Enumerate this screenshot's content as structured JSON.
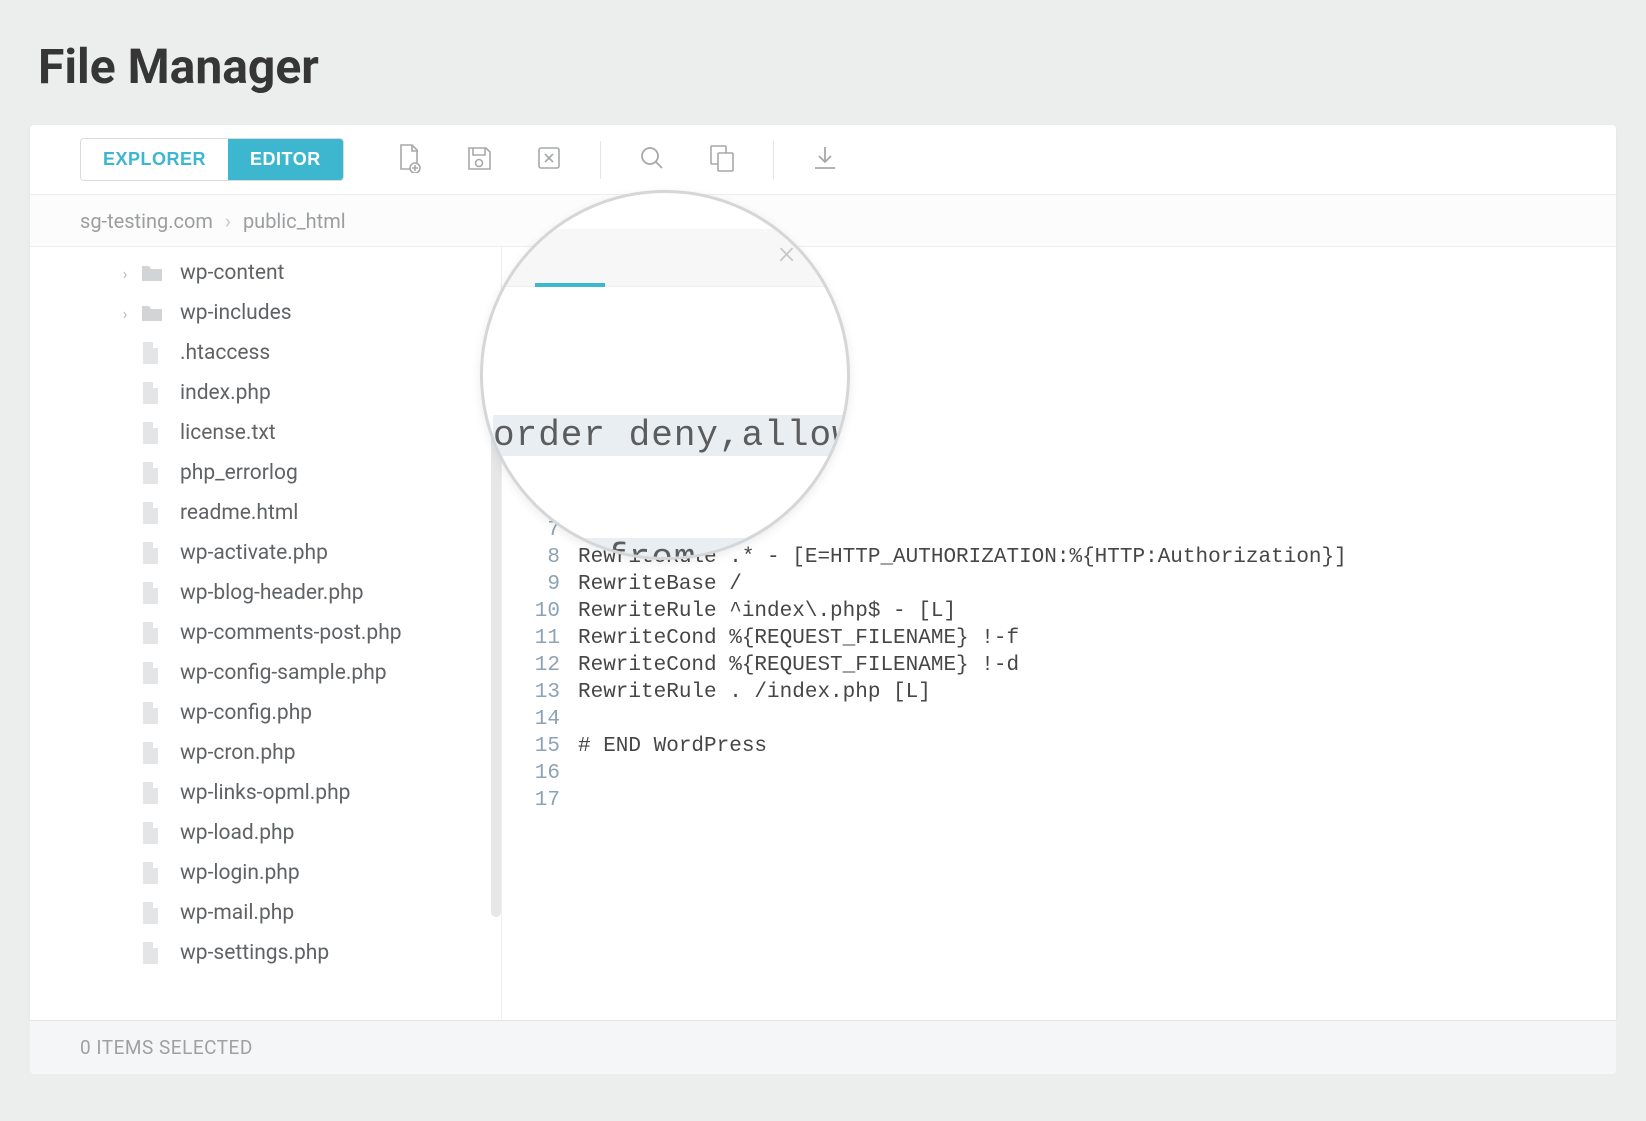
{
  "page": {
    "title": "File Manager"
  },
  "toolbar": {
    "tabs": {
      "explorer": "EXPLORER",
      "editor": "EDITOR",
      "active": "editor"
    }
  },
  "breadcrumb": {
    "parts": [
      "sg-testing.com",
      "public_html"
    ]
  },
  "sidebar": {
    "items": [
      {
        "type": "folder",
        "expandable": true,
        "label": "wp-content"
      },
      {
        "type": "folder",
        "expandable": true,
        "label": "wp-includes"
      },
      {
        "type": "file",
        "label": ".htaccess"
      },
      {
        "type": "file",
        "label": "index.php"
      },
      {
        "type": "file",
        "label": "license.txt"
      },
      {
        "type": "file",
        "label": "php_errorlog"
      },
      {
        "type": "file",
        "label": "readme.html"
      },
      {
        "type": "file",
        "label": "wp-activate.php"
      },
      {
        "type": "file",
        "label": "wp-blog-header.php"
      },
      {
        "type": "file",
        "label": "wp-comments-post.php"
      },
      {
        "type": "file",
        "label": "wp-config-sample.php"
      },
      {
        "type": "file",
        "label": "wp-config.php"
      },
      {
        "type": "file",
        "label": "wp-cron.php"
      },
      {
        "type": "file",
        "label": "wp-links-opml.php"
      },
      {
        "type": "file",
        "label": "wp-load.php"
      },
      {
        "type": "file",
        "label": "wp-login.php"
      },
      {
        "type": "file",
        "label": "wp-mail.php"
      },
      {
        "type": "file",
        "label": "wp-settings.php"
      }
    ]
  },
  "editor": {
    "lines": [
      {
        "num": "7",
        "text": ""
      },
      {
        "num": "8",
        "text": "RewriteRule .* - [E=HTTP_AUTHORIZATION:%{HTTP:Authorization}]"
      },
      {
        "num": "9",
        "text": "RewriteBase /"
      },
      {
        "num": "10",
        "text": "RewriteRule ^index\\.php$ - [L]"
      },
      {
        "num": "11",
        "text": "RewriteCond %{REQUEST_FILENAME} !-f"
      },
      {
        "num": "12",
        "text": "RewriteCond %{REQUEST_FILENAME} !-d"
      },
      {
        "num": "13",
        "text": "RewriteRule . /index.php [L]"
      },
      {
        "num": "14",
        "text": ""
      },
      {
        "num": "15",
        "text": "# END WordPress"
      },
      {
        "num": "16",
        "text": ""
      },
      {
        "num": "17",
        "text": ""
      }
    ]
  },
  "magnifier": {
    "line1": "order deny,allow",
    "line2": "deny from all"
  },
  "status": {
    "text": "0 ITEMS SELECTED"
  }
}
